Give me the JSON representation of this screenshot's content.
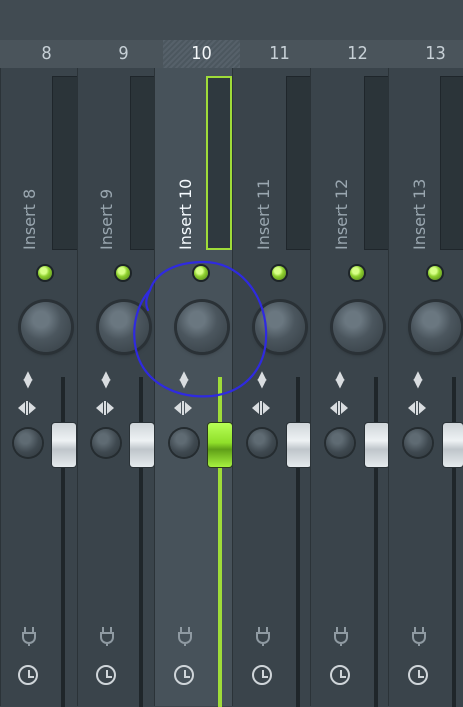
{
  "mixer": {
    "channels": [
      {
        "number": "8",
        "label": "Insert 8",
        "selected": false
      },
      {
        "number": "9",
        "label": "Insert 9",
        "selected": false
      },
      {
        "number": "10",
        "label": "Insert 10",
        "selected": true
      },
      {
        "number": "11",
        "label": "Insert 11",
        "selected": false
      },
      {
        "number": "12",
        "label": "Insert 12",
        "selected": false
      },
      {
        "number": "13",
        "label": "Insert 13",
        "selected": false
      }
    ]
  },
  "colors": {
    "accent": "#9fdc39",
    "annotation": "#2f2ae0"
  },
  "icons": {
    "updown": "updown-arrows-icon",
    "swap": "swap-arrows-icon",
    "slot": "plug-icon",
    "clock": "clock-icon"
  }
}
